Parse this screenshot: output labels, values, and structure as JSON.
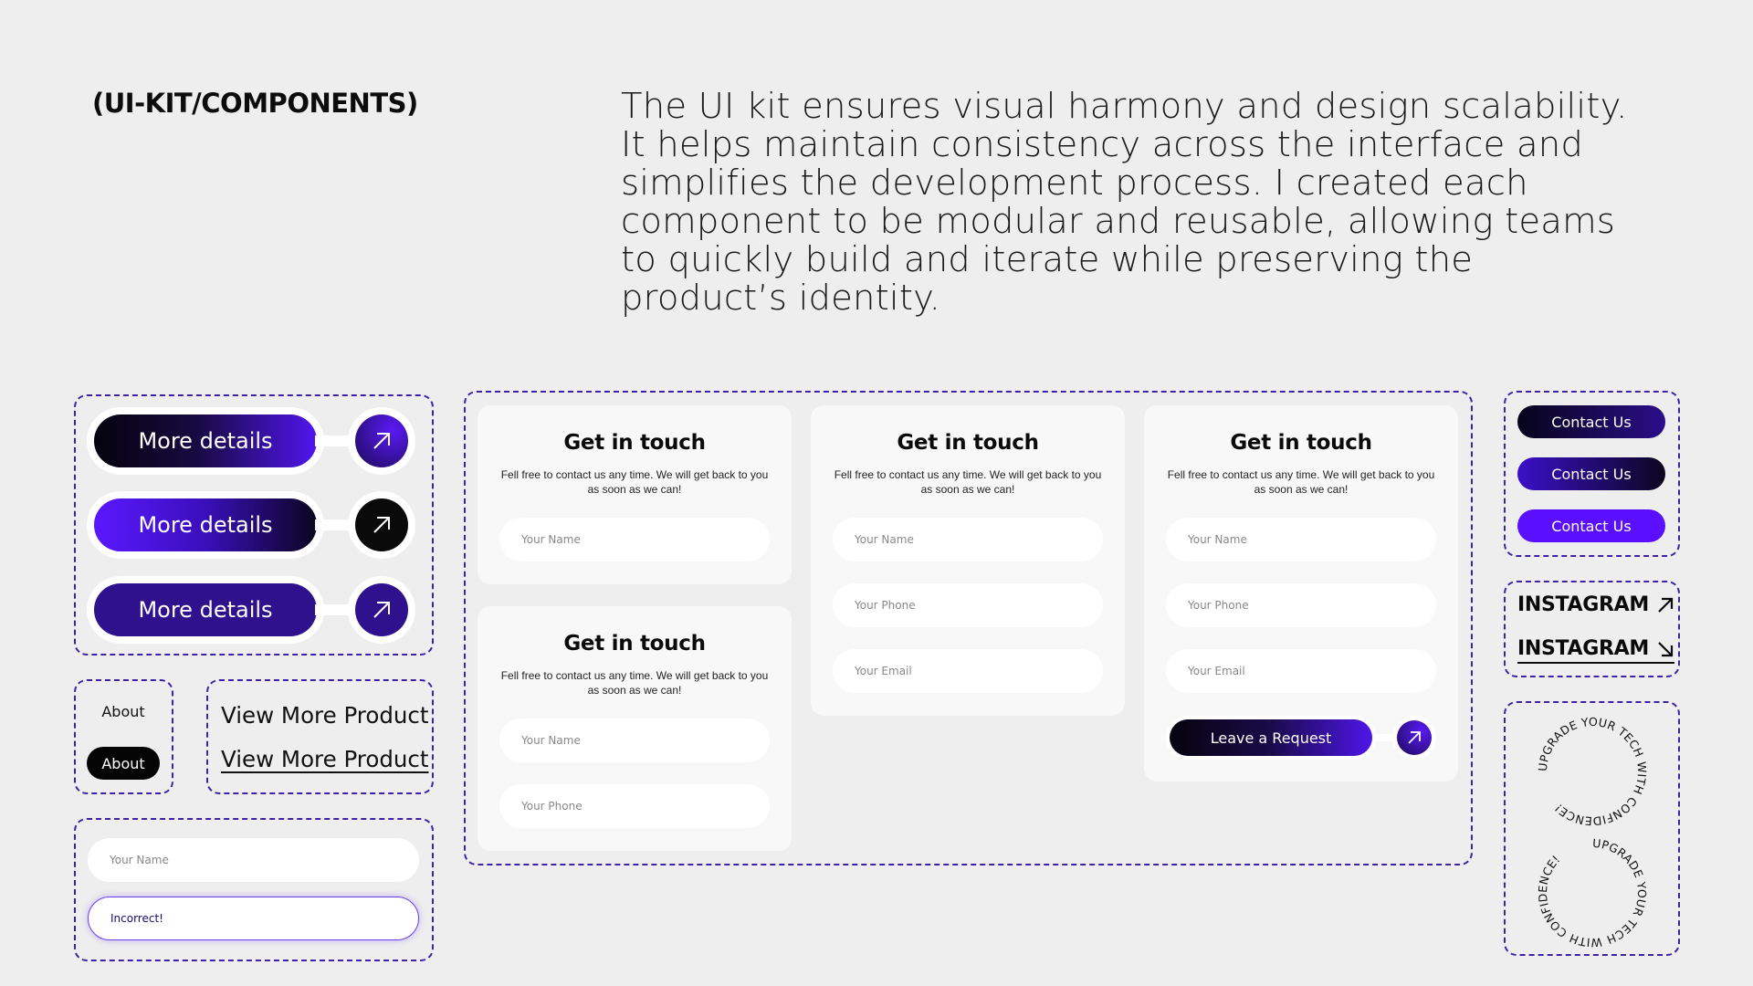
{
  "header": {
    "title": "(UI-KIT/COMPONENTS)",
    "description": "The UI kit ensures visual harmony and design scalability. It helps maintain consistency across the interface and simplifies the development process. I created each component to be modular and reusable, allowing teams to quickly build and iterate while preserving the product’s identity."
  },
  "buttons": {
    "more_details": [
      "More details",
      "More details",
      "More details"
    ],
    "about": [
      "About",
      "About"
    ],
    "view_more": [
      "View More Product",
      "View More Product"
    ],
    "contact_us": [
      "Contact Us",
      "Contact Us",
      "Contact Us"
    ],
    "instagram": [
      "INSTAGRAM",
      "INSTAGRAM"
    ],
    "leave_request": "Leave a Request"
  },
  "inputs": {
    "name_placeholder": "Your Name",
    "phone_placeholder": "Your Phone",
    "email_placeholder": "Your Email",
    "error_value": "Incorrect!"
  },
  "card": {
    "title": "Get in touch",
    "subtitle": "Fell free to contact us any time. We will get back to you as soon as we can!"
  },
  "badges": {
    "ring_text_1": "UPGRADE YOUR TECH WITH CONFIDENCE!",
    "ring_text_2": "UPGRADE YOUR TECH WITH CONFIDENCE!"
  },
  "colors": {
    "background": "#eeeeee",
    "accent_purple": "#5a10ff",
    "deep_purple": "#30118d",
    "dashed_border": "#3e22a6"
  },
  "icons": [
    "arrow-up-right-icon",
    "arrow-down-right-icon"
  ]
}
